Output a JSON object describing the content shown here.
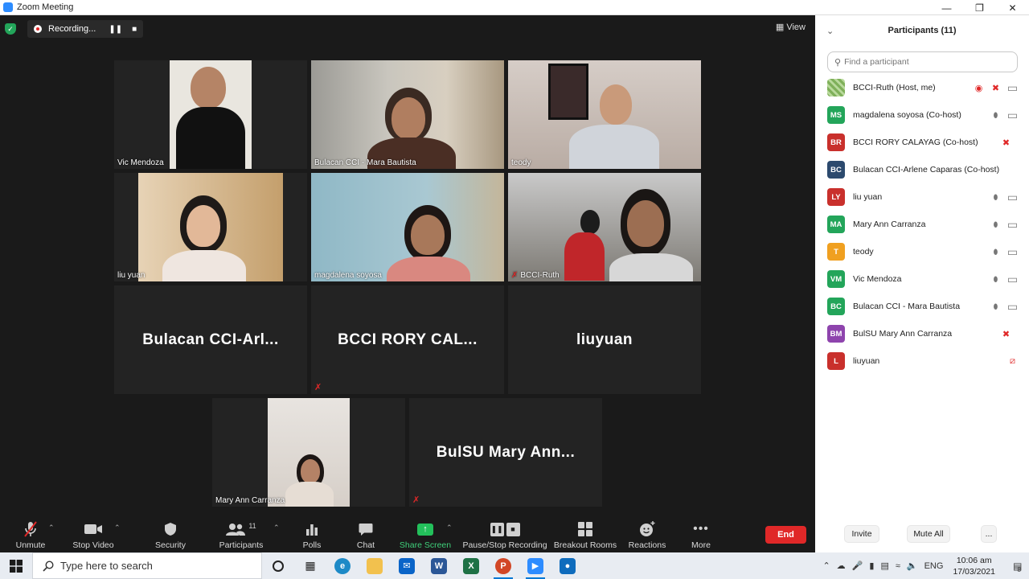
{
  "window": {
    "title": "Zoom Meeting"
  },
  "meeting": {
    "recording_label": "Recording...",
    "view_label": "View",
    "tiles": [
      {
        "name": "Vic Mendoza",
        "type": "video"
      },
      {
        "name": "Bulacan CCI - Mara Bautista",
        "type": "video"
      },
      {
        "name": "teody",
        "type": "video"
      },
      {
        "name": "liu yuan",
        "type": "video"
      },
      {
        "name": "magdalena soyosa",
        "type": "video",
        "active": true
      },
      {
        "name": "BCCI-Ruth",
        "type": "video",
        "muted": true
      },
      {
        "display": "Bulacan  CCI-Arl...",
        "type": "name"
      },
      {
        "display": "BCCI  RORY  CAL...",
        "type": "name",
        "muted": true
      },
      {
        "display": "liuyuan",
        "type": "name"
      },
      {
        "name": "Mary Ann Carranza",
        "type": "video"
      },
      {
        "display": "BulSU  Mary  Ann...",
        "type": "name",
        "muted": true
      }
    ]
  },
  "toolbar": {
    "unmute": "Unmute",
    "stop_video": "Stop Video",
    "security": "Security",
    "participants": "Participants",
    "participants_count": "11",
    "polls": "Polls",
    "chat": "Chat",
    "share_screen": "Share Screen",
    "pause_stop_recording": "Pause/Stop Recording",
    "breakout_rooms": "Breakout Rooms",
    "reactions": "Reactions",
    "more": "More",
    "end": "End"
  },
  "panel": {
    "title": "Participants (11)",
    "search_placeholder": "Find a participant",
    "participants": [
      {
        "initials": "",
        "name": "BCCI-Ruth (Host, me)",
        "color": "#8fbf6a",
        "rec": true,
        "mic": "muted",
        "video": "on"
      },
      {
        "initials": "MS",
        "name": "magdalena soyosa (Co-host)",
        "color": "#23a55a",
        "mic": "on",
        "video": "on"
      },
      {
        "initials": "BR",
        "name": "BCCI RORY CALAYAG (Co-host)",
        "color": "#c9302c",
        "mic": "muted",
        "video": "none"
      },
      {
        "initials": "BC",
        "name": "Bulacan CCI-Arlene Caparas (Co-host)",
        "color": "#2c4a6e",
        "mic": "none",
        "video": "none"
      },
      {
        "initials": "LY",
        "name": "liu yuan",
        "color": "#c9302c",
        "mic": "on",
        "video": "on"
      },
      {
        "initials": "MA",
        "name": "Mary Ann Carranza",
        "color": "#23a55a",
        "mic": "on",
        "video": "on"
      },
      {
        "initials": "T",
        "name": "teody",
        "color": "#f0a020",
        "mic": "on",
        "video": "on"
      },
      {
        "initials": "VM",
        "name": "Vic Mendoza",
        "color": "#23a55a",
        "mic": "on",
        "video": "on"
      },
      {
        "initials": "BC",
        "name": "Bulacan CCI - Mara Bautista",
        "color": "#23a55a",
        "mic": "on",
        "video": "on"
      },
      {
        "initials": "BM",
        "name": "BulSU Mary Ann Carranza",
        "color": "#8e44ad",
        "mic": "muted",
        "video": "none"
      },
      {
        "initials": "L",
        "name": "liuyuan",
        "color": "#c9302c",
        "mic": "none",
        "video": "off"
      }
    ],
    "invite": "Invite",
    "mute_all": "Mute All",
    "more": "..."
  },
  "taskbar": {
    "search_placeholder": "Type here to search",
    "lang": "ENG",
    "time": "10:06 am",
    "date": "17/03/2021",
    "notifications": "8"
  }
}
